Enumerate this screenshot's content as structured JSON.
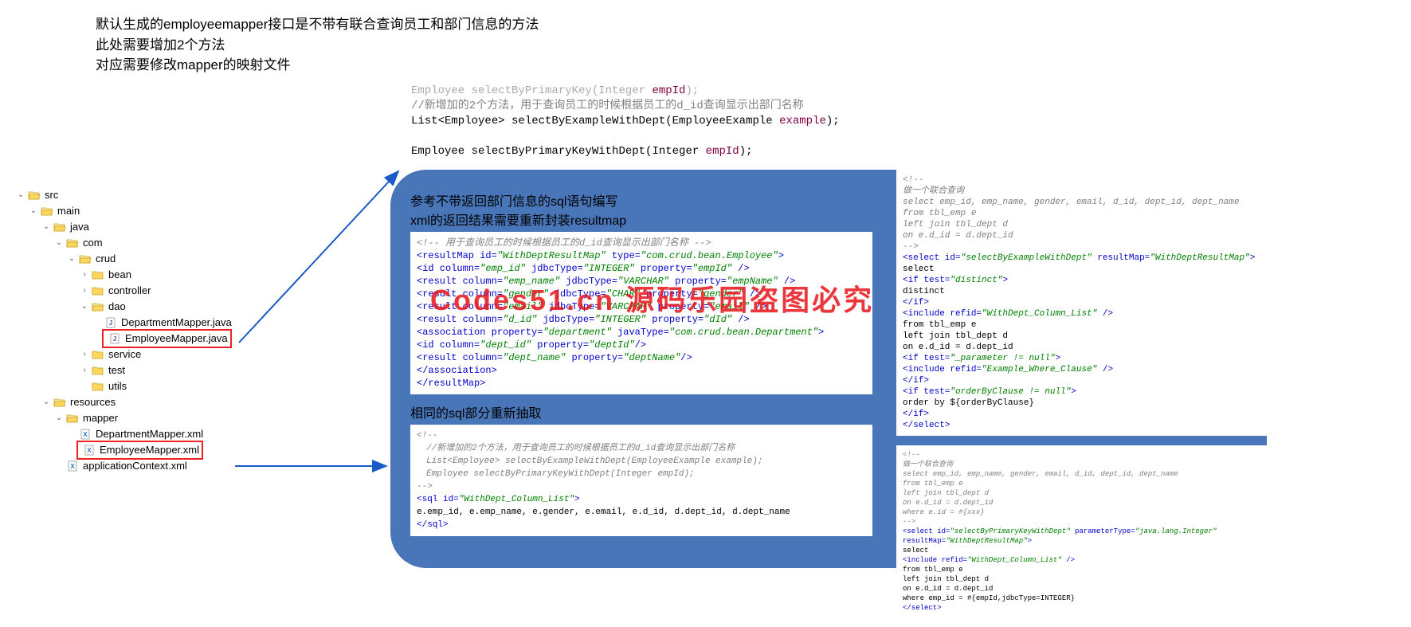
{
  "header": {
    "line1": "默认生成的employeemapper接口是不带有联合查询员工和部门信息的方法",
    "line2": "此处需要增加2个方法",
    "line3": "对应需要修改mapper的映射文件"
  },
  "tree": {
    "src": "src",
    "main": "main",
    "java": "java",
    "com": "com",
    "crud": "crud",
    "bean": "bean",
    "controller": "controller",
    "dao": "dao",
    "deptMapper": "DepartmentMapper.java",
    "empMapper": "EmployeeMapper.java",
    "service": "service",
    "test": "test",
    "utils": "utils",
    "resources": "resources",
    "mapper": "mapper",
    "deptXml": "DepartmentMapper.xml",
    "empXml": "EmployeeMapper.xml",
    "appCtx": "applicationContext.xml"
  },
  "codeTop": {
    "l0a": "Employee selectByPrimaryKey(Integer ",
    "l0b": "empId",
    "l0c": ");",
    "l1": "//新增加的2个方法，用于查询员工的时候根据员工的d_id查询显示出部门名称",
    "l2a": "List<Employee> selectByExampleWithDept(EmployeeExample ",
    "l2b": "example",
    "l2c": ");",
    "l3a": "Employee selectByPrimaryKeyWithDept(Integer ",
    "l3b": "empId",
    "l3c": ");"
  },
  "panel": {
    "title1a": "参考不带返回部门信息的sql语句编写",
    "title1b": "xml的返回结果需要重新封装resultmap",
    "title2": "相同的sql部分重新抽取"
  },
  "box1": {
    "c1": "<!--  用于查询员工的时候根据员工的d_id查询显示出部门名称 -->",
    "l1": {
      "pre": "<resultMap id=",
      "v1": "\"WithDeptResultMap\"",
      "mid": " type=",
      "v2": "\"com.crud.bean.Employee\"",
      "post": ">"
    },
    "l2": {
      "pre": "  <id column=",
      "v1": "\"emp_id\"",
      "m1": " jdbcType=",
      "v2": "\"INTEGER\"",
      "m2": " property=",
      "v3": "\"empId\"",
      "post": " />"
    },
    "l3": {
      "pre": "  <result column=",
      "v1": "\"emp_name\"",
      "m1": " jdbcType=",
      "v2": "\"VARCHAR\"",
      "m2": " property=",
      "v3": "\"empName\"",
      "post": " />"
    },
    "l4": {
      "pre": "  <result column=",
      "v1": "\"gender\"",
      "m1": " jdbcType=",
      "v2": "\"CHAR\"",
      "m2": " property=",
      "v3": "\"gender\"",
      "post": " />"
    },
    "l5": {
      "pre": "  <result column=",
      "v1": "\"email\"",
      "m1": " jdbcType=",
      "v2": "\"VARCHAR\"",
      "m2": " property=",
      "v3": "\"email\"",
      "post": " />"
    },
    "l6": {
      "pre": "  <result column=",
      "v1": "\"d_id\"",
      "m1": " jdbcType=",
      "v2": "\"INTEGER\"",
      "m2": " property=",
      "v3": "\"dId\"",
      "post": " />"
    },
    "l7": {
      "pre": "  <association property=",
      "v1": "\"department\"",
      "m1": " javaType=",
      "v2": "\"com.crud.bean.Department\"",
      "post": ">"
    },
    "l8": {
      "pre": "      <id column=",
      "v1": "\"dept_id\"",
      "m1": " property=",
      "v2": "\"deptId\"",
      "post": "/>"
    },
    "l9": {
      "pre": "      <result column=",
      "v1": "\"dept_name\"",
      "m1": " property=",
      "v2": "\"deptName\"",
      "post": "/>"
    },
    "l10": "  </association>",
    "l11": "</resultMap>"
  },
  "box2": {
    "c1": "<!--",
    "c2": "//新增加的2个方法，用于查询员工的时候根据员工的d_id查询显示出部门名称",
    "c3": "List<Employee> selectByExampleWithDept(EmployeeExample example);",
    "c4": "",
    "c5": "Employee selectByPrimaryKeyWithDept(Integer empId);",
    "c6": "-->",
    "l1": {
      "pre": "<sql id=",
      "v1": "\"WithDept_Column_List\"",
      "post": ">"
    },
    "l2": "  e.emp_id, e.emp_name, e.gender, e.email, e.d_id, d.dept_id, d.dept_name",
    "l3": "</sql>"
  },
  "rbox1": {
    "c1": "<!--",
    "c2": "做一个联合查询",
    "c3": "select emp_id, emp_name, gender, email, d_id, dept_id, dept_name",
    "c4": "from tbl_emp e",
    "c5": "left join tbl_dept d",
    "c6": "on e.d_id = d.dept_id",
    "c7": " -->",
    "l1": {
      "pre": "<select id=",
      "v1": "\"selectByExampleWithDept\"",
      "m1": " resultMap=",
      "v2": "\"WithDeptResultMap\"",
      "post": ">"
    },
    "l2": "    select",
    "l3": {
      "pre": "  <if test=",
      "v1": "\"distinct\"",
      "post": ">"
    },
    "l4": "    distinct",
    "l5": "  </if>",
    "l6": {
      "pre": "  <include refid=",
      "v1": "\"WithDept_Column_List\"",
      "post": " />"
    },
    "l7": "  from tbl_emp e",
    "l8": "  left join tbl_dept d",
    "l9": "  on e.d_id = d.dept_id",
    "l10": {
      "pre": "  <if test=",
      "v1": "\"_parameter != null\"",
      "post": ">"
    },
    "l11": {
      "pre": "    <include refid=",
      "v1": "\"Example_Where_Clause\"",
      "post": " />"
    },
    "l12": "  </if>",
    "l13": {
      "pre": "  <if test=",
      "v1": "\"orderByClause != null\"",
      "post": ">"
    },
    "l14": "    order by ${orderByClause}",
    "l15": "  </if>",
    "l16": "</select>"
  },
  "rbox2": {
    "c1": "<!--",
    "c2": "做一个联合查询",
    "c3": "select emp_id, emp_name, gender, email, d_id, dept_id, dept_name",
    "c4": "from tbl_emp e",
    "c5": "left join tbl_dept d",
    "c6": "on e.d_id = d.dept_id",
    "c7": "where e.id = #{xxx}",
    "c8": " -->",
    "l1": {
      "pre": "<select id=",
      "v1": "\"selectByPrimaryKeyWithDept\"",
      "m1": " parameterType=",
      "v2": "\"java.lang.Integer\"",
      "m2": " resultMap=",
      "v3": "\"WithDeptResultMap\"",
      "post": ">"
    },
    "l2": "  select",
    "l3": {
      "pre": "  <include refid=",
      "v1": "\"WithDept_Column_List\"",
      "post": " />"
    },
    "l4": "  from tbl_emp e",
    "l5": "  left join tbl_dept d",
    "l6": "  on e.d_id = d.dept_id",
    "l7": "  where emp_id = #{empId,jdbcType=INTEGER}",
    "l8": "</select>"
  },
  "watermark": "Codes51.cn 源码乐园盗图必究"
}
